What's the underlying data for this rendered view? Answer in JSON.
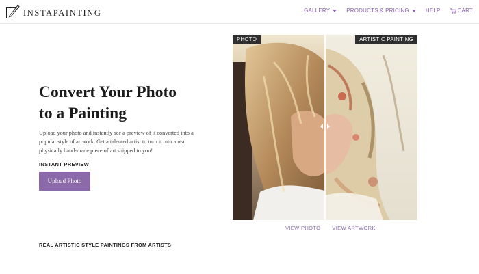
{
  "header": {
    "logo_text": "INSTAPAINTING",
    "nav": [
      {
        "label": "GALLERY",
        "dropdown": true
      },
      {
        "label": "PRODUCTS & PRICING",
        "dropdown": true
      },
      {
        "label": "HELP",
        "dropdown": false
      },
      {
        "label": "CART",
        "icon": "cart-icon"
      }
    ]
  },
  "hero": {
    "title_line1": "Convert Your Photo",
    "title_line2": "to a Painting",
    "description": "Upload your photo and instantly see a preview of it converted into a popular style of artwork. Get a talented artist to turn it into a real physically hand-made piece of art shipped to you!",
    "instant_preview_label": "INSTANT PREVIEW",
    "upload_button": "Upload Photo"
  },
  "compare": {
    "photo_label": "PHOTO",
    "painting_label": "ARTISTIC PAINTING",
    "view_photo": "VIEW PHOTO",
    "view_artwork": "VIEW ARTWORK",
    "divider_position": 0.5
  },
  "section": {
    "title": "REAL ARTISTIC STYLE PAINTINGS FROM ARTISTS"
  },
  "colors": {
    "accent": "#8b5fb0",
    "button_bg": "#8c6aa9",
    "badge_bg": "#2f2f2f"
  }
}
